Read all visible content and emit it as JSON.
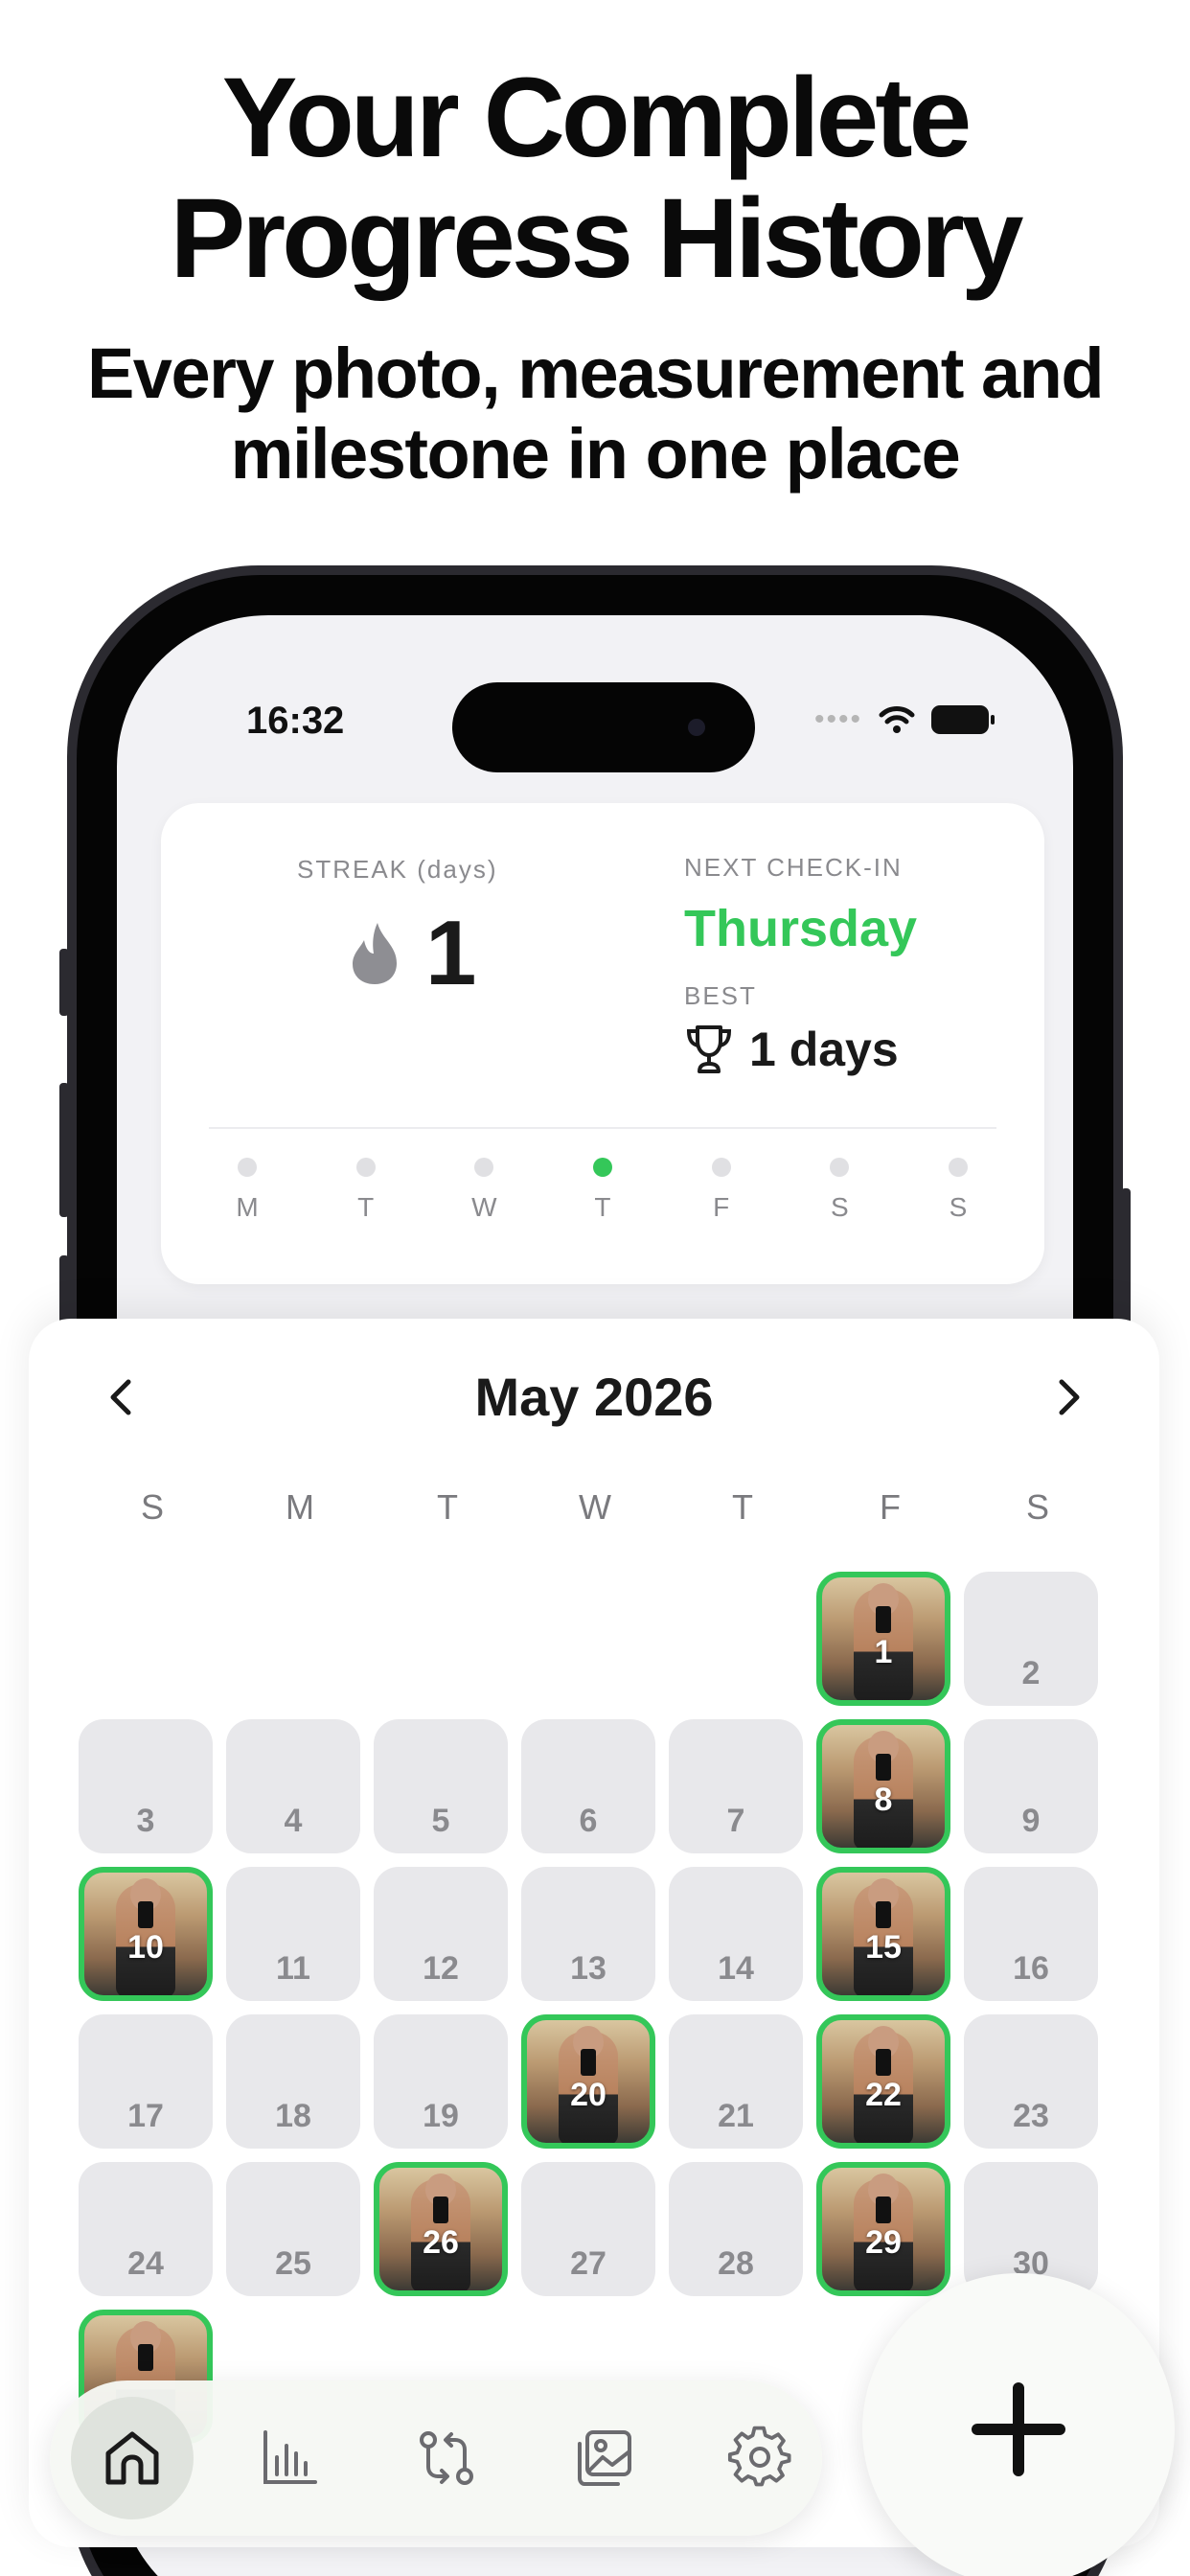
{
  "headline": {
    "title_line1": "Your Complete",
    "title_line2": "Progress History",
    "subtitle_line1": "Every photo, measurement and",
    "subtitle_line2": "milestone in one place"
  },
  "status_bar": {
    "time": "16:32",
    "signal": "••••"
  },
  "streak_card": {
    "streak_label": "STREAK (days)",
    "streak_value": "1",
    "next_label": "NEXT CHECK-IN",
    "next_value": "Thursday",
    "best_label": "BEST",
    "best_value": "1 days",
    "week": [
      {
        "label": "M",
        "done": false
      },
      {
        "label": "T",
        "done": false
      },
      {
        "label": "W",
        "done": false
      },
      {
        "label": "T",
        "done": true
      },
      {
        "label": "F",
        "done": false
      },
      {
        "label": "S",
        "done": false
      },
      {
        "label": "S",
        "done": false
      }
    ]
  },
  "calendar": {
    "month_title": "May 2026",
    "weekdays": [
      "S",
      "M",
      "T",
      "W",
      "T",
      "F",
      "S"
    ],
    "leading_blanks": 5,
    "days": [
      {
        "n": "1",
        "photo": true
      },
      {
        "n": "2",
        "photo": false
      },
      {
        "n": "3",
        "photo": false
      },
      {
        "n": "4",
        "photo": false
      },
      {
        "n": "5",
        "photo": false
      },
      {
        "n": "6",
        "photo": false
      },
      {
        "n": "7",
        "photo": false
      },
      {
        "n": "8",
        "photo": true
      },
      {
        "n": "9",
        "photo": false
      },
      {
        "n": "10",
        "photo": true
      },
      {
        "n": "11",
        "photo": false
      },
      {
        "n": "12",
        "photo": false
      },
      {
        "n": "13",
        "photo": false
      },
      {
        "n": "14",
        "photo": false
      },
      {
        "n": "15",
        "photo": true
      },
      {
        "n": "16",
        "photo": false
      },
      {
        "n": "17",
        "photo": false
      },
      {
        "n": "18",
        "photo": false
      },
      {
        "n": "19",
        "photo": false
      },
      {
        "n": "20",
        "photo": true
      },
      {
        "n": "21",
        "photo": false
      },
      {
        "n": "22",
        "photo": true
      },
      {
        "n": "23",
        "photo": false
      },
      {
        "n": "24",
        "photo": false
      },
      {
        "n": "25",
        "photo": false
      },
      {
        "n": "26",
        "photo": true
      },
      {
        "n": "27",
        "photo": false
      },
      {
        "n": "28",
        "photo": false
      },
      {
        "n": "29",
        "photo": true
      },
      {
        "n": "30",
        "photo": false
      },
      {
        "n": "",
        "photo": true
      }
    ]
  },
  "tabbar": {
    "tabs": [
      {
        "icon": "home-icon",
        "active": true
      },
      {
        "icon": "chart-icon",
        "active": false
      },
      {
        "icon": "compare-icon",
        "active": false
      },
      {
        "icon": "gallery-icon",
        "active": false
      },
      {
        "icon": "settings-icon",
        "active": false
      }
    ],
    "fab_icon": "plus-icon"
  },
  "colors": {
    "accent": "#34c759",
    "cell": "#e8e8eb",
    "text": "#1a1a1a"
  }
}
